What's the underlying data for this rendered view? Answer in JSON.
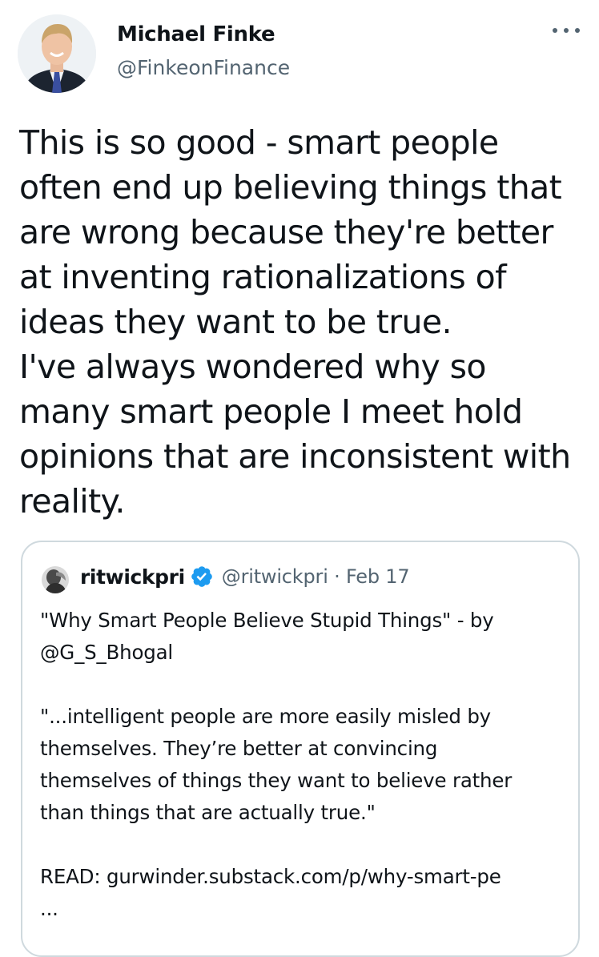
{
  "tweet": {
    "author_name": "Michael Finke",
    "author_handle": "@FinkeonFinance",
    "text_lines": [
      "This is so good - smart people",
      "often end up believing things that",
      "are wrong because they're better",
      "at inventing rationalizations of",
      "ideas they want to be true.",
      "I've always wondered why so",
      "many smart people I meet hold",
      "opinions that are inconsistent with",
      "reality."
    ],
    "more_icon": "more-horizontal-icon"
  },
  "quoted_tweet": {
    "author_name": "ritwickpri",
    "verified_icon": "verified-badge-icon",
    "meta": "@ritwickpri · Feb 17",
    "text_lines": [
      "\"Why Smart People Believe Stupid Things\" - by",
      "@G_S_Bhogal",
      "",
      "\"...intelligent people are more easily misled by",
      "themselves. They’re better at convincing",
      "themselves of things they want to believe rather",
      "than things that are actually true.\"",
      "",
      "READ: gurwinder.substack.com/p/why-smart-pe",
      "..."
    ]
  },
  "colors": {
    "text": "#0f1419",
    "secondary": "#536471",
    "border": "#cfd9de",
    "verified": "#1d9bf0"
  }
}
